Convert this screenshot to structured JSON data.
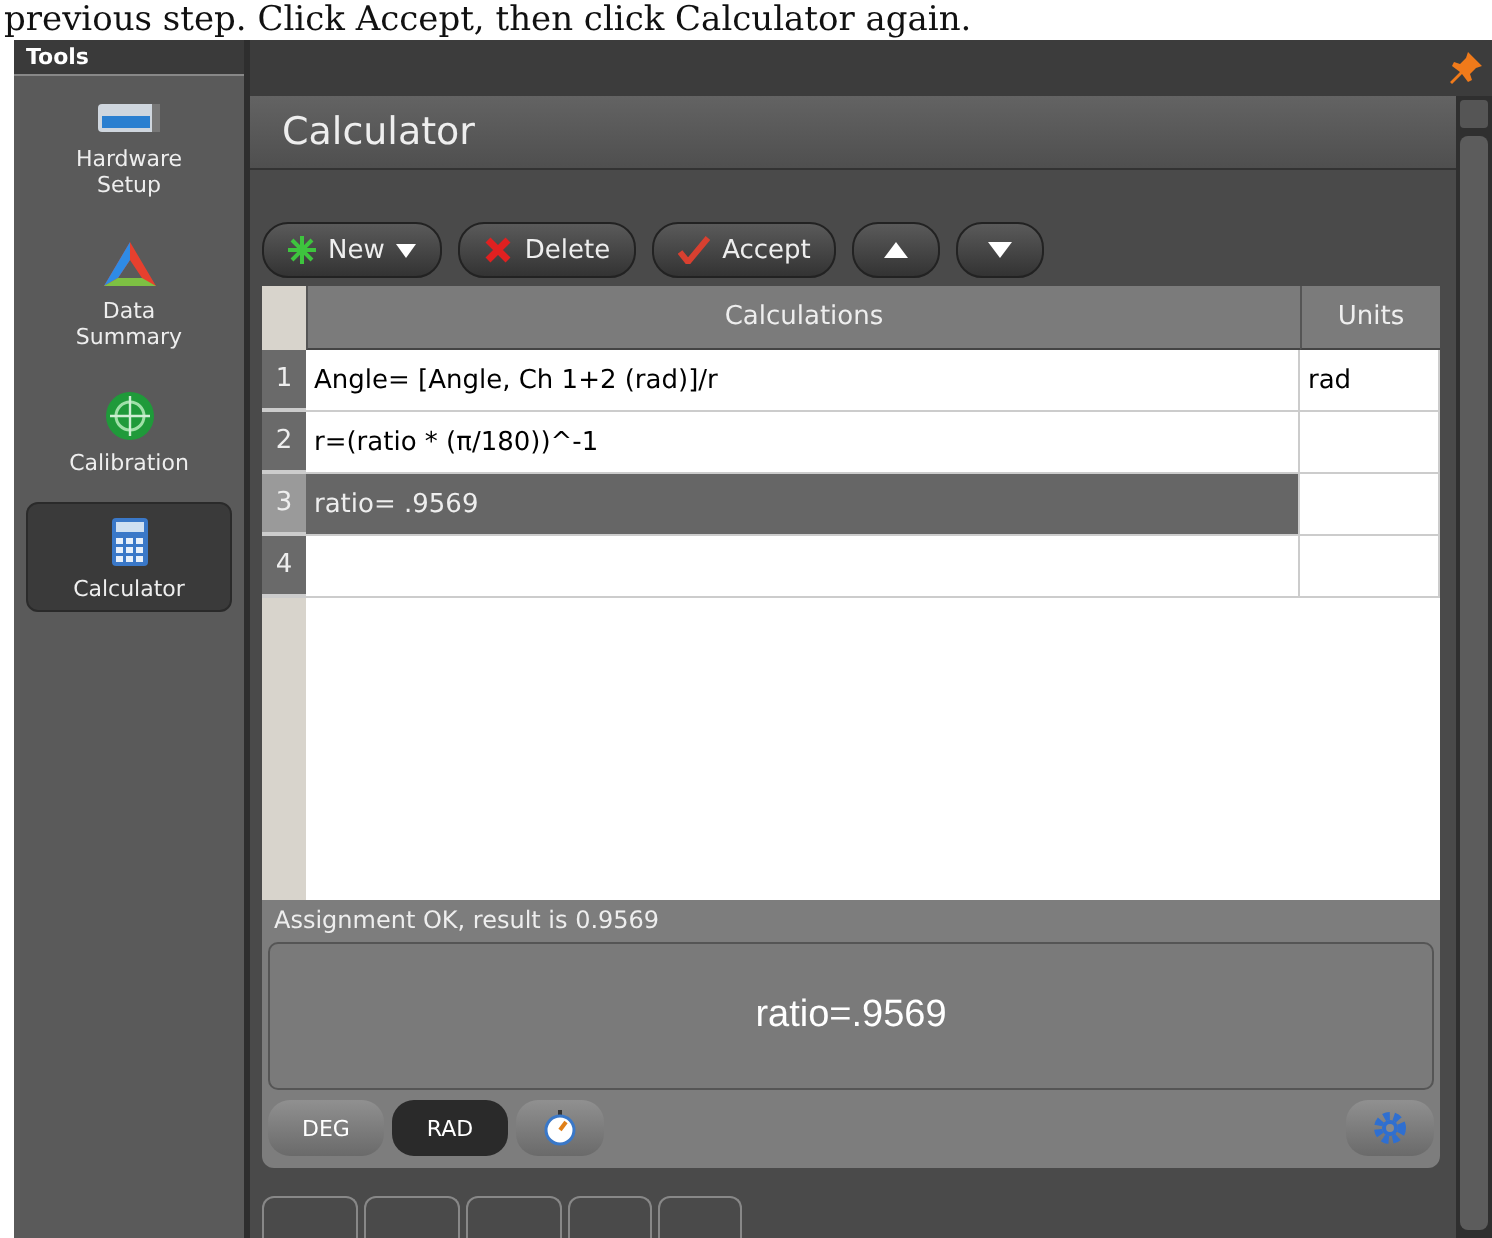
{
  "caption": "previous step. Click Accept, then click Calculator again.",
  "sidebar": {
    "title": "Tools",
    "items": [
      {
        "label": "Hardware Setup",
        "kind": "hardware",
        "selected": false
      },
      {
        "label": "Data Summary",
        "kind": "summary",
        "selected": false
      },
      {
        "label": "Calibration",
        "kind": "calibration",
        "selected": false
      },
      {
        "label": "Calculator",
        "kind": "calculator",
        "selected": true
      }
    ]
  },
  "panel": {
    "title": "Calculator"
  },
  "toolbar": [
    {
      "label": "New",
      "kind": "new"
    },
    {
      "label": "Delete",
      "kind": "delete"
    },
    {
      "label": "Accept",
      "kind": "accept"
    },
    {
      "kind": "up"
    },
    {
      "kind": "down"
    }
  ],
  "table": {
    "columns": [
      "Calculations",
      "Units"
    ],
    "rows": [
      {
        "number": "1",
        "calculation": "Angle= [Angle, Ch 1+2 (rad)]/r",
        "units": "rad",
        "selected": false
      },
      {
        "number": "2",
        "calculation": "r=(ratio * (π/180))^-1",
        "units": "",
        "selected": false
      },
      {
        "number": "3",
        "calculation": "ratio= .9569",
        "units": "",
        "selected": true
      },
      {
        "number": "4",
        "calculation": "",
        "units": "",
        "selected": false
      }
    ]
  },
  "status": "Assignment OK, result is 0.9569",
  "display": "ratio=.9569",
  "modes": [
    {
      "label": "DEG",
      "selected": false
    },
    {
      "label": "RAD",
      "selected": true
    }
  ]
}
